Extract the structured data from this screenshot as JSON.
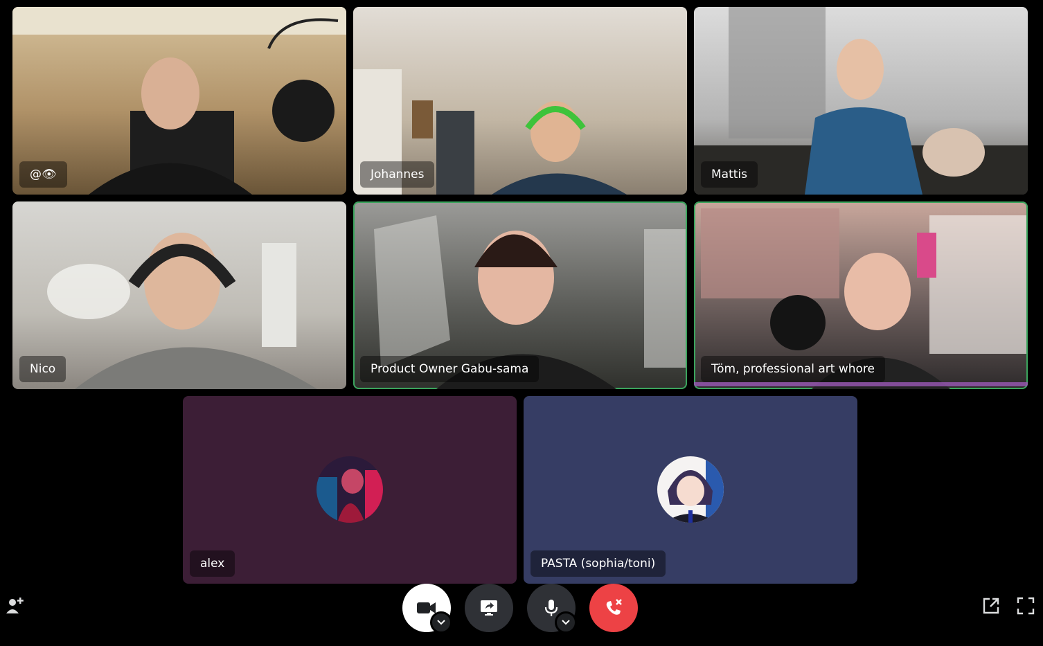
{
  "participants": [
    {
      "name": "@👁",
      "bg": "#b89f78"
    },
    {
      "name": "Johannes",
      "bg": "#c7beae"
    },
    {
      "name": "Mattis",
      "bg": "#a8a7a4"
    },
    {
      "name": "Nico",
      "bg": "#b9b6ae"
    },
    {
      "name": "Product Owner Gabu-sama",
      "bg": "#6e6f6b"
    },
    {
      "name": "Töm, professional art whore",
      "bg": "#7a6a66"
    },
    {
      "name": "alex",
      "bg": "#3c1e36"
    },
    {
      "name": "PASTA (sophia/toni)",
      "bg": "#363d64"
    }
  ],
  "controls": {
    "camera": "video-camera-icon",
    "screen_share": "screen-share-icon",
    "microphone": "microphone-icon",
    "disconnect": "disconnect-phone-icon"
  },
  "colors": {
    "speaking_border": "#3ba55d",
    "disconnect_red": "#ed4245"
  }
}
